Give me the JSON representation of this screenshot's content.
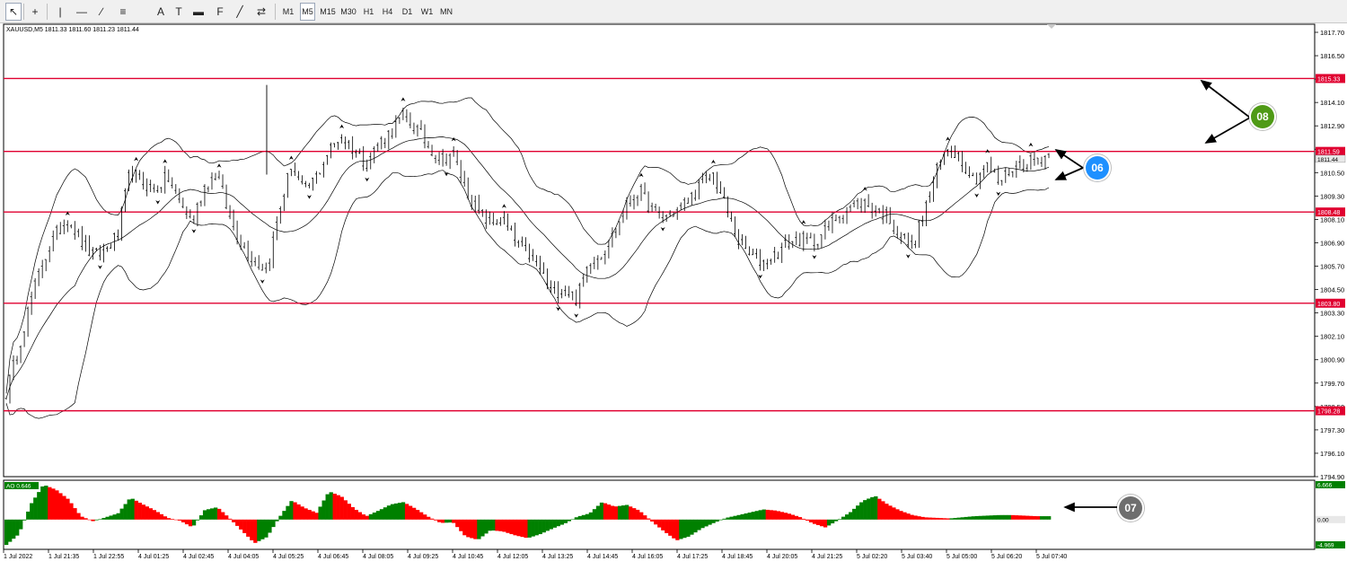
{
  "toolbar": {
    "timeframes": [
      "M1",
      "M5",
      "M15",
      "M30",
      "H1",
      "H4",
      "D1",
      "W1",
      "MN"
    ],
    "active_timeframe": "M5",
    "tools": [
      "cursor-icon",
      "crosshair-icon",
      "vertical-line-icon",
      "horizontal-line-icon",
      "trendline-icon",
      "channel-icon",
      "text-icon",
      "label-icon",
      "rectangle-icon",
      "fibonacci-icon",
      "gann-icon",
      "arrows-icon"
    ]
  },
  "chart": {
    "header": "XAUUSD,M5  1811.33 1811.60 1811.23 1811.44",
    "price_ticks": [
      "1817.70",
      "1816.50",
      "1815.30",
      "1814.10",
      "1812.90",
      "1811.70",
      "1810.50",
      "1809.30",
      "1808.10",
      "1806.90",
      "1805.70",
      "1804.50",
      "1803.30",
      "1802.10",
      "1800.90",
      "1799.70",
      "1798.50",
      "1797.30",
      "1796.10",
      "1794.90"
    ],
    "level_labels": [
      {
        "label": "1815.33",
        "value": 1815.33
      },
      {
        "label": "1811.59",
        "value": 1811.59
      },
      {
        "label": "1808.48",
        "value": 1808.48
      },
      {
        "label": "1803.80",
        "value": 1803.8
      },
      {
        "label": "1798.28",
        "value": 1798.28
      }
    ],
    "current_price_label": "1811.44",
    "time_labels": [
      "1 Jul 2022",
      "1 Jul 21:35",
      "1 Jul 22:55",
      "4 Jul 01:25",
      "4 Jul 02:45",
      "4 Jul 04:05",
      "4 Jul 05:25",
      "4 Jul 06:45",
      "4 Jul 08:05",
      "4 Jul 09:25",
      "4 Jul 10:45",
      "4 Jul 12:05",
      "4 Jul 13:25",
      "4 Jul 14:45",
      "4 Jul 16:05",
      "4 Jul 17:25",
      "4 Jul 18:45",
      "4 Jul 20:05",
      "4 Jul 21:25",
      "5 Jul 02:20",
      "5 Jul 03:40",
      "5 Jul 05:00",
      "5 Jul 06:20",
      "5 Jul 07:40"
    ]
  },
  "indicator": {
    "name": "AO 0.646",
    "scale_top": "6.666",
    "scale_mid": "0.00",
    "scale_bottom": "-4.969"
  },
  "colors": {
    "level_line": "#e00030",
    "ao_up": "#008000",
    "ao_down": "#ff0000",
    "callout_06": "#1e90ff",
    "callout_07": "#6e6e6e",
    "callout_08": "#4f9a16"
  },
  "callouts": [
    {
      "id": "06",
      "label": "06"
    },
    {
      "id": "07",
      "label": "07"
    },
    {
      "id": "08",
      "label": "08"
    }
  ],
  "chart_data": {
    "type": "candlestick",
    "symbol": "XAUUSD",
    "timeframe": "M5",
    "ohlc_last": {
      "open": 1811.33,
      "high": 1811.6,
      "low": 1811.23,
      "close": 1811.44
    },
    "price_path": [
      1799.2,
      1801.5,
      1804.0,
      1806.0,
      1807.3,
      1808.2,
      1807.0,
      1806.2,
      1806.5,
      1807.3,
      1810.6,
      1810.0,
      1809.6,
      1810.3,
      1809.0,
      1808.0,
      1809.8,
      1810.5,
      1808.2,
      1806.8,
      1806.0,
      1805.5,
      1808.5,
      1811.0,
      1809.5,
      1810.3,
      1811.6,
      1812.4,
      1811.7,
      1811.0,
      1812.0,
      1812.6,
      1813.4,
      1812.8,
      1811.9,
      1811.2,
      1811.5,
      1809.7,
      1808.5,
      1807.9,
      1808.1,
      1807.0,
      1806.4,
      1805.6,
      1804.3,
      1804.6,
      1804.0,
      1806.0,
      1806.3,
      1807.4,
      1808.8,
      1809.6,
      1808.6,
      1808.2,
      1808.5,
      1809.1,
      1809.9,
      1810.4,
      1808.7,
      1807.0,
      1806.2,
      1805.9,
      1806.3,
      1806.9,
      1807.1,
      1806.9,
      1807.5,
      1808.3,
      1808.7,
      1809.0,
      1808.6,
      1808.3,
      1807.3,
      1806.7,
      1808.5,
      1810.6,
      1811.9,
      1811.2,
      1810.1,
      1810.9,
      1810.0,
      1810.7,
      1811.0,
      1811.2,
      1811.4
    ],
    "horizontal_levels": [
      1815.33,
      1811.59,
      1808.48,
      1803.8,
      1798.28
    ],
    "y_range": [
      1794.9,
      1817.7
    ],
    "ao_range": [
      -4.969,
      6.666
    ],
    "ao_values": [
      -4.5,
      -2.6,
      2.8,
      6.2,
      5.3,
      3.6,
      0.6,
      -0.3,
      0.4,
      1.1,
      3.9,
      2.7,
      1.6,
      0.3,
      -0.2,
      -1.4,
      1.7,
      2.2,
      0.2,
      -2.0,
      -4.2,
      -3.1,
      0.4,
      3.4,
      2.1,
      1.2,
      5.0,
      4.1,
      2.0,
      0.6,
      1.6,
      2.7,
      3.1,
      1.9,
      0.5,
      -0.6,
      -0.5,
      -3.0,
      -3.6,
      -1.9,
      -2.1,
      -2.8,
      -3.3,
      -2.6,
      -1.6,
      -0.7,
      0.5,
      1.1,
      3.1,
      2.3,
      2.6,
      1.6,
      -0.3,
      -2.1,
      -3.7,
      -3.0,
      -1.6,
      -0.6,
      0.3,
      0.8,
      1.3,
      1.8,
      1.6,
      1.1,
      0.4,
      -0.7,
      -1.4,
      -0.1,
      1.3,
      3.3,
      4.2,
      2.7,
      1.6,
      0.8,
      0.4,
      0.3,
      0.2,
      0.4,
      0.6,
      0.7,
      0.8,
      0.8,
      0.7,
      0.6,
      0.6
    ]
  }
}
